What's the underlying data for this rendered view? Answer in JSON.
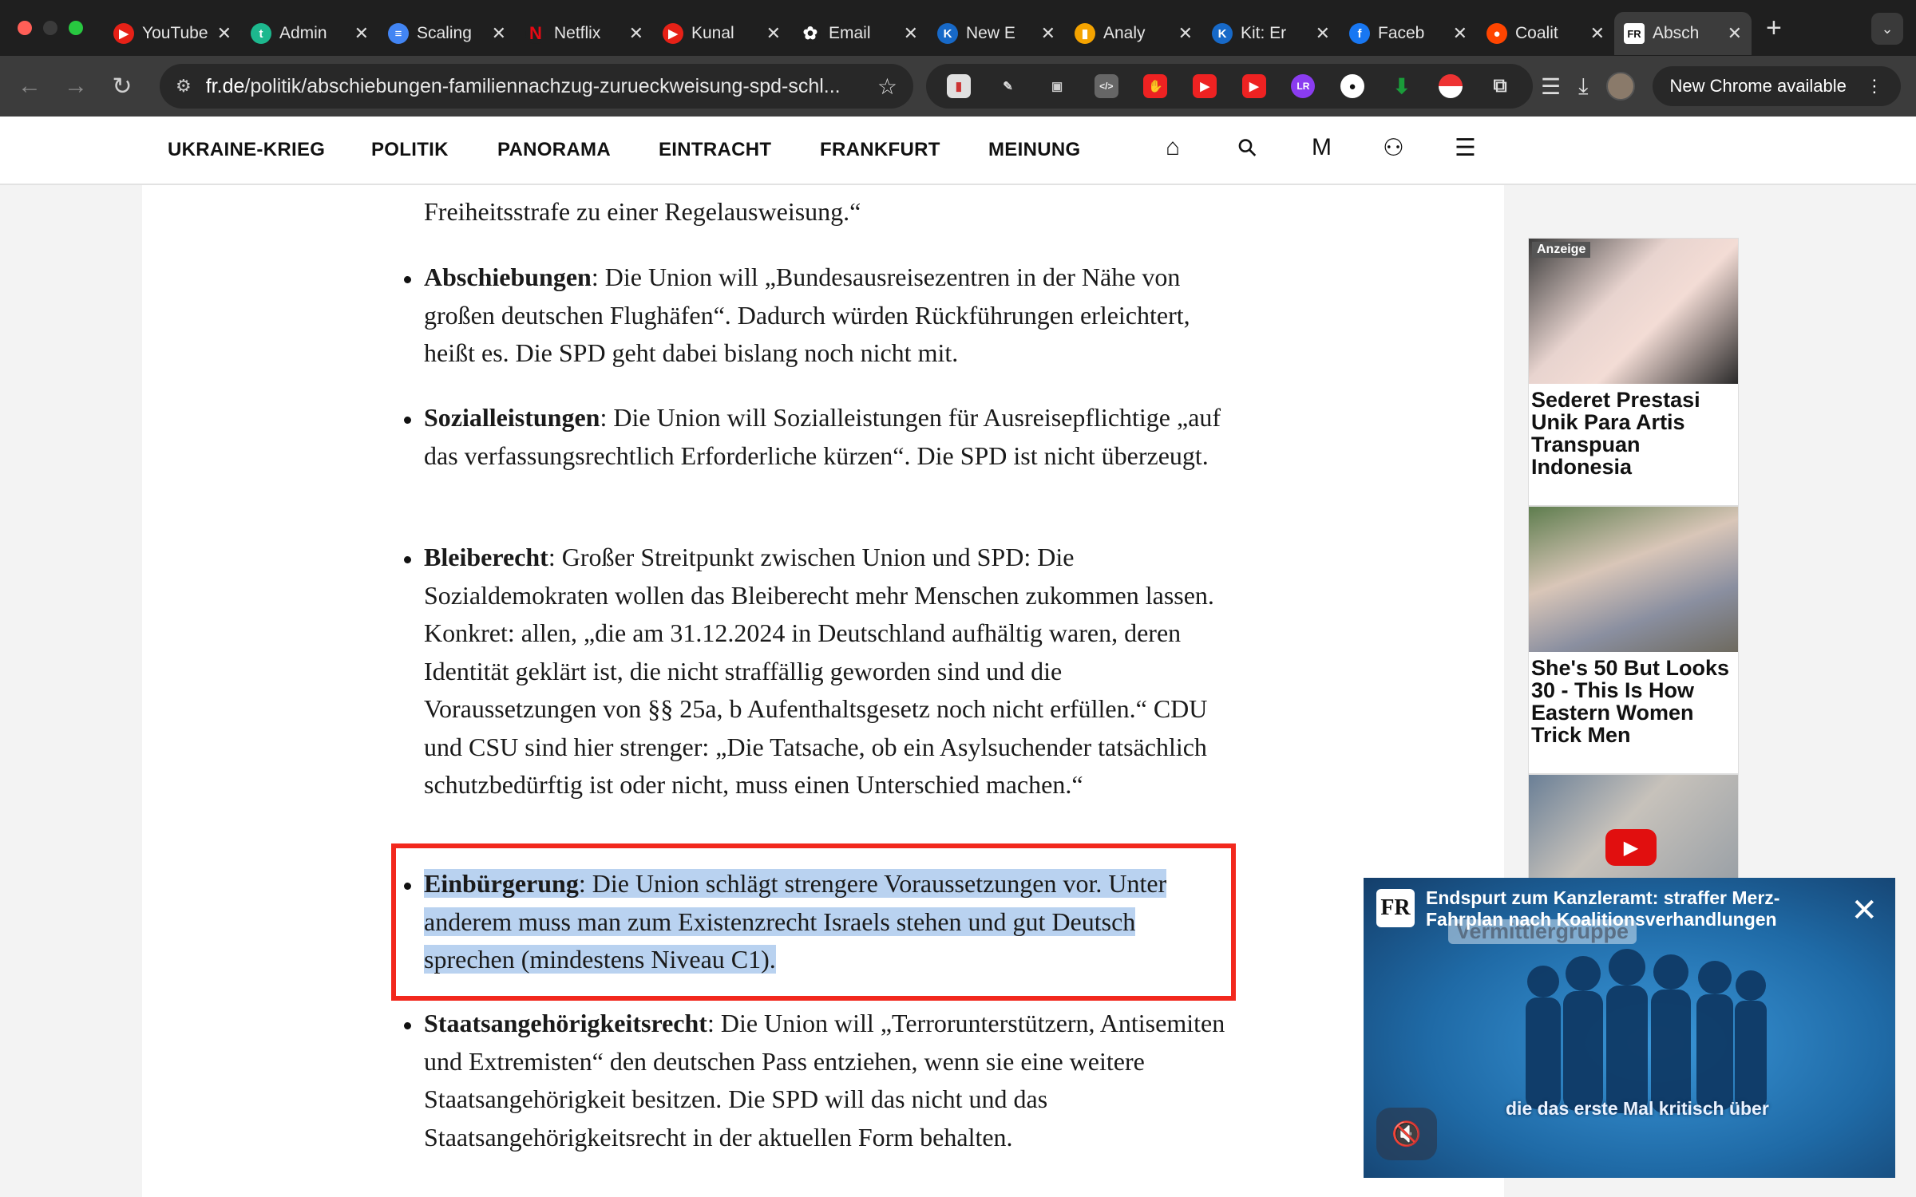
{
  "browser": {
    "tabs": [
      {
        "title": "YouTube",
        "icon": "youtube-icon",
        "fav": "▶",
        "color": "#e62117"
      },
      {
        "title": "Admin",
        "icon": "admin-icon",
        "fav": "t",
        "color": "#1db88e"
      },
      {
        "title": "Scaling",
        "icon": "docs-icon",
        "fav": "≡",
        "color": "#4285f4"
      },
      {
        "title": "Netflix",
        "icon": "netflix-icon",
        "fav": "N",
        "color": "#1f1f1f"
      },
      {
        "title": "Kunal",
        "icon": "youtube-icon",
        "fav": "▶",
        "color": "#e62117"
      },
      {
        "title": "Email",
        "icon": "openai-icon",
        "fav": "✿",
        "color": "#1f1f1f"
      },
      {
        "title": "New E",
        "icon": "k-icon",
        "fav": "K",
        "color": "#1769c8"
      },
      {
        "title": "Analy",
        "icon": "analytics-icon",
        "fav": "▮",
        "color": "#f4a300"
      },
      {
        "title": "Kit: Er",
        "icon": "k-icon",
        "fav": "K",
        "color": "#1769c8"
      },
      {
        "title": "Faceb",
        "icon": "facebook-icon",
        "fav": "f",
        "color": "#1877f2"
      },
      {
        "title": "Coalit",
        "icon": "reddit-icon",
        "fav": "●",
        "color": "#ff4500"
      },
      {
        "title": "Absch",
        "icon": "fr-icon",
        "fav": "FR",
        "color": "#ffffff"
      }
    ],
    "url_host": "fr.de",
    "url_path": "/politik/abschiebungen-familiennachzug-zurueckweisung-spd-schl...",
    "new_chrome": "New Chrome available"
  },
  "site_nav": {
    "items": [
      "UKRAINE-KRIEG",
      "POLITIK",
      "PANORAMA",
      "EINTRACHT",
      "FRANKFURT",
      "MEINUNG"
    ]
  },
  "article": {
    "lead_tail": "Freiheitsstrafe zu einer Regelausweisung.“",
    "bullets": [
      {
        "term": "Abschiebungen",
        "text": ": Die Union will „Bundesausreisezentren in der Nähe von großen deutschen Flughäfen“. Dadurch würden Rückführungen erleichtert, heißt es. Die SPD geht dabei bislang noch nicht mit."
      },
      {
        "term": "Sozialleistungen",
        "text": ": Die Union will Sozialleistungen für Ausreisepflichtige „auf das verfassungsrechtlich Erforderliche kürzen“. Die SPD ist nicht überzeugt."
      },
      {
        "term": "Bleiberecht",
        "text": ": Großer Streitpunkt zwischen Union und SPD: Die Sozialdemokraten wollen das Bleiberecht mehr Menschen zukommen lassen. Konkret: allen, „die am 31.12.2024 in Deutschland aufhältig waren, deren Identität geklärt ist, die nicht straffällig geworden sind und die Voraussetzungen von §§ 25a, b Aufenthaltsgesetz noch nicht erfüllen.“ CDU und CSU sind hier strenger: „Die Tatsache, ob ein Asylsuchender tatsächlich schutzbedürftig ist oder nicht, muss einen Unterschied machen.“"
      },
      {
        "term": "Einbürgerung",
        "text": ": Die Union schlägt strengere Voraussetzungen vor. Unter anderem muss man zum Existenzrecht Israels stehen und gut Deutsch sprechen (mindestens Niveau C1)."
      },
      {
        "term": "Staatsangehörigkeitsrecht",
        "text": ": Die Union will „Terrorunterstützern, Antisemiten und Extremisten“ den deutschen Pass entziehen, wenn sie eine weitere Staatsangehörigkeit besitzen. Die SPD will das nicht und das Staatsangehörigkeitsrecht in der aktuellen Form behalten."
      }
    ]
  },
  "ads": {
    "tag": "Anzeige",
    "cards": [
      {
        "title": "Sederet Prestasi Unik Para Artis Transpuan Indonesia"
      },
      {
        "title": "She's 50 But Looks 30 - This Is How Eastern Women Trick Men"
      }
    ]
  },
  "video": {
    "title": "Endspurt zum Kanzleramt: straffer Merz-Fahrplan nach Koalitionsverhandlungen",
    "banner": "Vermittlergruppe",
    "caption": "die das erste Mal kritisch über",
    "logo": "FR"
  },
  "colors": {
    "highlight": "#b9d2f0",
    "annotation": "#f2281d"
  }
}
